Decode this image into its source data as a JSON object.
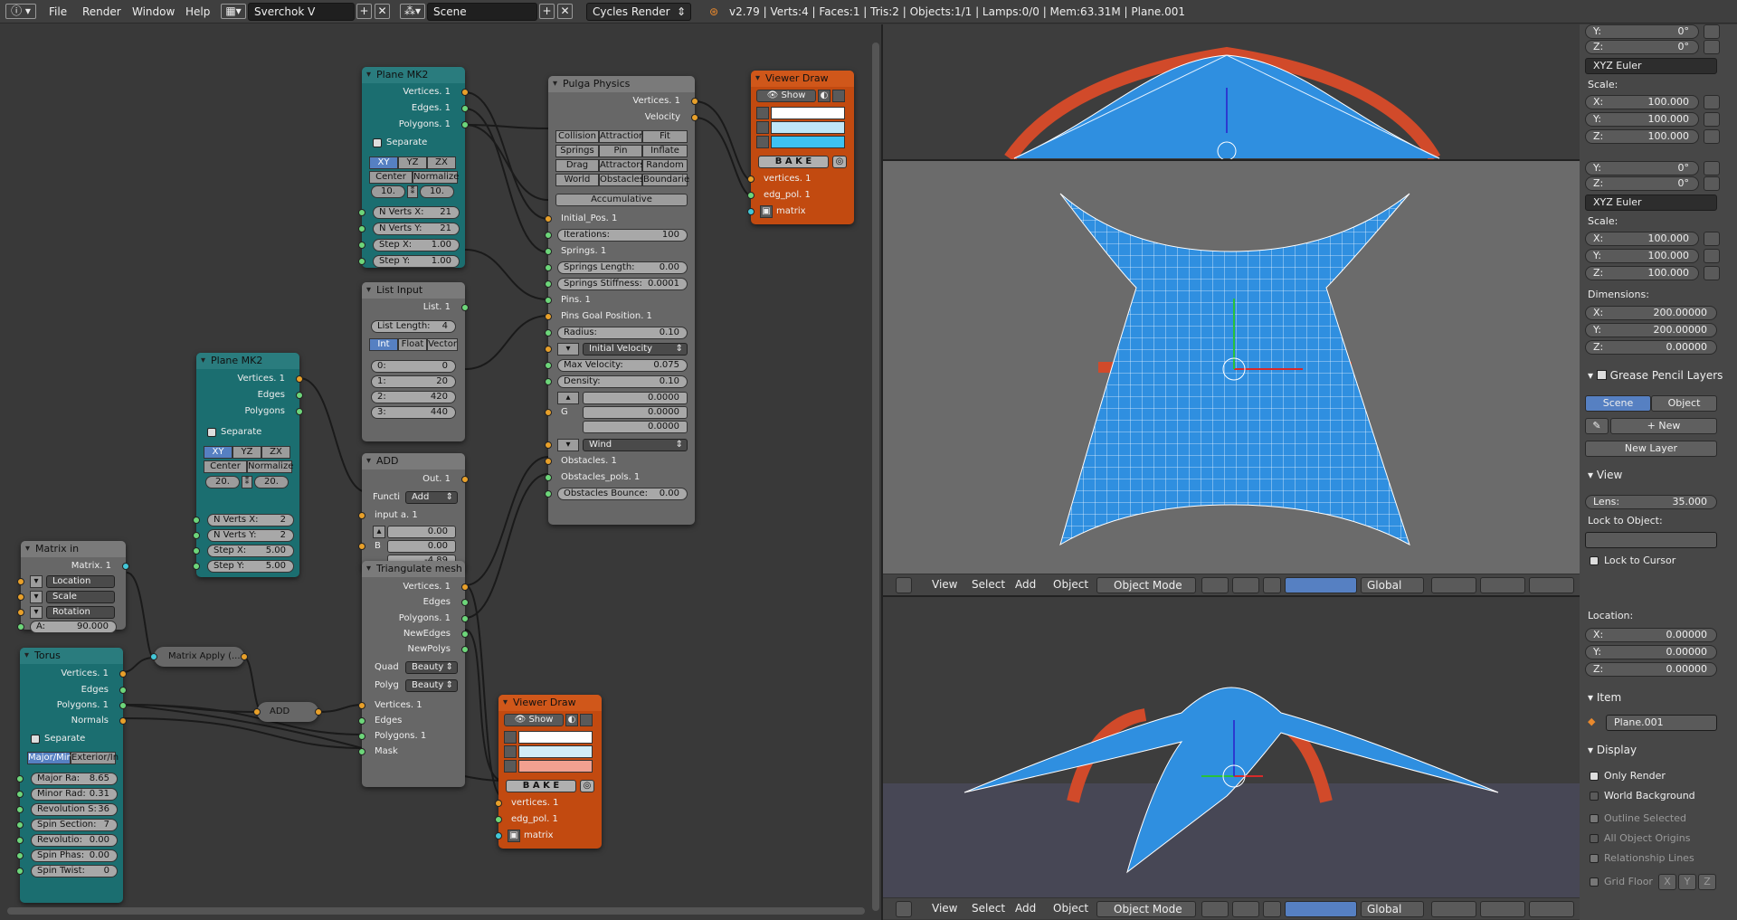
{
  "topbar": {
    "menus": [
      "File",
      "Render",
      "Window",
      "Help"
    ],
    "screen": "Sverchok V",
    "scene": "Scene",
    "engine": "Cycles Render",
    "stats": "v2.79 | Verts:4 | Faces:1 | Tris:2 | Objects:1/1 | Lamps:0/0 | Mem:63.31M | Plane.001"
  },
  "nodes": {
    "plane1": {
      "title": "Plane MK2",
      "outs": [
        "Vertices. 1",
        "Edges. 1",
        "Polygons. 1"
      ],
      "separate": "Separate",
      "axes": [
        "XY",
        "YZ",
        "ZX"
      ],
      "modes": [
        "Center",
        "Normalize"
      ],
      "size": [
        "10.",
        "10."
      ],
      "fields": [
        [
          "N Verts X:",
          "21"
        ],
        [
          "N Verts Y:",
          "21"
        ],
        [
          "Step X:",
          "1.00"
        ],
        [
          "Step Y:",
          "1.00"
        ]
      ]
    },
    "listin": {
      "title": "List Input",
      "out": "List. 1",
      "len_label": "List Length:",
      "len": "4",
      "types": [
        "Int",
        "Float",
        "Vector"
      ],
      "items": [
        [
          "0:",
          "0"
        ],
        [
          "1:",
          "20"
        ],
        [
          "2:",
          "420"
        ],
        [
          "3:",
          "440"
        ]
      ]
    },
    "plane2": {
      "title": "Plane MK2",
      "outs": [
        "Vertices. 1",
        "Edges",
        "Polygons"
      ],
      "separate": "Separate",
      "axes": [
        "XY",
        "YZ",
        "ZX"
      ],
      "modes": [
        "Center",
        "Normalize"
      ],
      "size": [
        "20.",
        "20."
      ],
      "fields": [
        [
          "N Verts X:",
          "2"
        ],
        [
          "N Verts Y:",
          "2"
        ],
        [
          "Step X:",
          "5.00"
        ],
        [
          "Step Y:",
          "5.00"
        ]
      ]
    },
    "add1": {
      "title": "ADD",
      "out": "Out. 1",
      "func_label": "Functi",
      "func": "Add",
      "in_a": "input a. 1",
      "b": "B",
      "vals": [
        "0.00",
        "0.00",
        "-4.89"
      ]
    },
    "matrixin": {
      "title": "Matrix in",
      "out": "Matrix. 1",
      "rows": [
        "Location",
        "Scale",
        "Rotation"
      ],
      "angle_label": "A:",
      "angle": "90.000"
    },
    "torus": {
      "title": "Torus",
      "outs": [
        "Vertices. 1",
        "Edges",
        "Polygons. 1",
        "Normals"
      ],
      "separate": "Separate",
      "modes": [
        "Major/Min",
        "Exterior/In"
      ],
      "fields": [
        [
          "Major Ra:",
          "8.65"
        ],
        [
          "Minor Rad:",
          "0.31"
        ],
        [
          "Revolution S:",
          "36"
        ],
        [
          "Spin Section:",
          "7"
        ],
        [
          "Revolutio:",
          "0.00"
        ],
        [
          "Spin Phas:",
          "0.00"
        ],
        [
          "Spin Twist:",
          "0"
        ]
      ]
    },
    "matapply": {
      "title": "Matrix Apply (..."
    },
    "add2": {
      "title": "ADD"
    },
    "tri": {
      "title": "Triangulate mesh",
      "outs": [
        "Vertices. 1",
        "Edges",
        "Polygons. 1",
        "NewEdges",
        "NewPolys"
      ],
      "quad_label": "Quad",
      "quad": "Beauty",
      "poly_label": "Polyg",
      "poly": "Beauty",
      "ins": [
        "Vertices. 1",
        "Edges",
        "Polygons. 1",
        "Mask"
      ]
    },
    "pulga": {
      "title": "Pulga Physics",
      "outs": [
        "Vertices. 1",
        "Velocity"
      ],
      "grid": [
        [
          "Collision",
          "Attraction",
          "Fit"
        ],
        [
          "Springs",
          "Pin",
          "Inflate"
        ],
        [
          "Drag",
          "Attractors",
          "Random"
        ],
        [
          "World",
          "Obstacles",
          "Boundarie"
        ]
      ],
      "accum": "Accumulative",
      "initpos": "Initial_Pos. 1",
      "fields1": [
        [
          "Iterations:",
          "100"
        ]
      ],
      "springs": "Springs. 1",
      "fields2": [
        [
          "Springs Length:",
          "0.00"
        ],
        [
          "Springs Stiffness:",
          "0.0001"
        ]
      ],
      "pins": "Pins. 1",
      "pinsgoal": "Pins Goal Position. 1",
      "radius": [
        "Radius:",
        "0.10"
      ],
      "initvel": "Initial Velocity",
      "fields3": [
        [
          "Max Velocity:",
          "0.075"
        ],
        [
          "Density:",
          "0.10"
        ]
      ],
      "g": "G",
      "gvals": [
        "0.0000",
        "0.0000",
        "0.0000"
      ],
      "wind": "Wind",
      "obst": "Obstacles. 1",
      "obstpols": "Obstacles_pols. 1",
      "bounce": [
        "Obstacles Bounce:",
        "0.00"
      ]
    },
    "viewer1": {
      "title": "Viewer Draw",
      "show": "Show",
      "bake": "B A K E",
      "ins": [
        "vertices. 1",
        "edg_pol. 1",
        "matrix"
      ],
      "colors": [
        "#ffffff",
        "#bfe6f7",
        "#3ec2f2"
      ]
    },
    "viewer2": {
      "title": "Viewer Draw",
      "show": "Show",
      "bake": "B A K E",
      "ins": [
        "vertices. 1",
        "edg_pol. 1",
        "matrix"
      ],
      "colors": [
        "#ffffff",
        "#d2ecf6",
        "#f2a090"
      ]
    }
  },
  "npanel": {
    "top": {
      "y": [
        "Y:",
        "0°"
      ],
      "z": [
        "Z:",
        "0°"
      ],
      "euler": "XYZ Euler",
      "scale": "Scale:",
      "sx": [
        "X:",
        "100.000"
      ],
      "sy": [
        "Y:",
        "100.000"
      ],
      "sz": [
        "Z:",
        "100.000"
      ]
    },
    "mid": {
      "y": [
        "Y:",
        "0°"
      ],
      "z": [
        "Z:",
        "0°"
      ],
      "euler": "XYZ Euler",
      "scale": "Scale:",
      "sx": [
        "X:",
        "100.000"
      ],
      "sy": [
        "Y:",
        "100.000"
      ],
      "sz": [
        "Z:",
        "100.000"
      ],
      "dims": "Dimensions:",
      "dx": [
        "X:",
        "200.00000"
      ],
      "dy": [
        "Y:",
        "200.00000"
      ],
      "dz": [
        "Z:",
        "0.00000"
      ],
      "gp": "Grease Pencil Layers",
      "scene": "Scene",
      "object": "Object",
      "new": "New",
      "newlayer": "New Layer",
      "view": "View",
      "lens": [
        "Lens:",
        "35.000"
      ],
      "lockobj": "Lock to Object:",
      "lockcursor": "Lock to Cursor"
    },
    "bot": {
      "loc": "Location:",
      "lx": [
        "X:",
        "0.00000"
      ],
      "ly": [
        "Y:",
        "0.00000"
      ],
      "lz": [
        "Z:",
        "0.00000"
      ],
      "item": "Item",
      "objname": "Plane.001",
      "display": "Display",
      "only_render": "Only Render",
      "world_bg": "World Background",
      "outline": "Outline Selected",
      "origins": "All Object Origins",
      "rel": "Relationship Lines",
      "grid": "Grid Floor",
      "gx": "X",
      "gy": "Y",
      "gz": "Z"
    }
  },
  "vheader": {
    "menus": [
      "View",
      "Select",
      "Add",
      "Object"
    ],
    "mode": "Object Mode",
    "orient": "Global"
  }
}
